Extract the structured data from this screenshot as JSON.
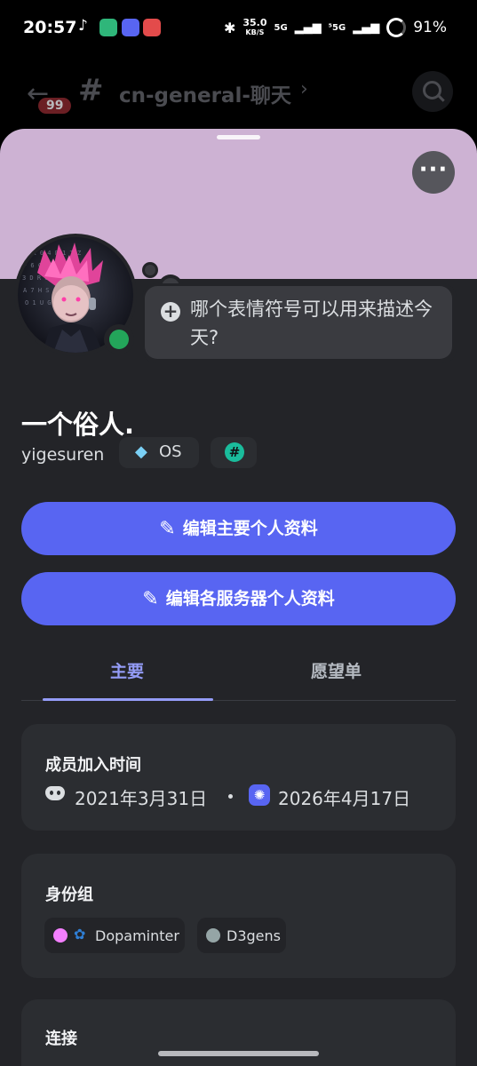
{
  "status_bar": {
    "time": "20:57",
    "net_speed_value": "35.0",
    "net_speed_unit": "KB/S",
    "signal1": "5G",
    "signal2": "⁵5G",
    "battery": "91%",
    "icons": [
      "tiktok-icon",
      "app-icon",
      "discord-icon",
      "game-icon",
      "bluetooth-icon",
      "battery-icon"
    ]
  },
  "channel_header": {
    "badge": "99",
    "channel_name": "cn-general-聊天"
  },
  "profile": {
    "status_prompt": "哪个表情符号可以用来描述今天?",
    "display_name": "一个俗人.",
    "username": "yigesuren",
    "tag_label": "OS",
    "online_color": "#23a55a"
  },
  "buttons": {
    "edit_main": "编辑主要个人资料",
    "edit_server": "编辑各服务器个人资料"
  },
  "tabs": {
    "main": "主要",
    "wishlist": "愿望单"
  },
  "member_since": {
    "title": "成员加入时间",
    "discord_date": "2021年3月31日",
    "server_date": "2026年4月17日"
  },
  "roles": {
    "title": "身份组",
    "items": [
      {
        "name": "Dopaminter",
        "color": "#f47fff"
      },
      {
        "name": "D3gens",
        "color": "#95a5a6"
      }
    ]
  },
  "connections": {
    "title": "连接"
  },
  "colors": {
    "banner": "#cdb2d3",
    "accent": "#5865f2",
    "tab_active": "#949cf7",
    "sheet_bg": "#232428"
  }
}
